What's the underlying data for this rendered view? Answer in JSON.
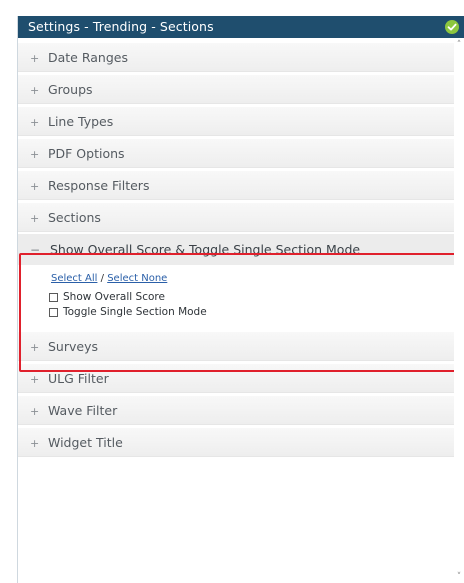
{
  "header": {
    "title": "Settings - Trending - Sections",
    "status_icon": "check-circle-icon",
    "status_color": "#8cc63f",
    "background": "#1f4e6e"
  },
  "sections_before": [
    {
      "sign": "+",
      "label": "Date Ranges"
    },
    {
      "sign": "+",
      "label": "Groups"
    },
    {
      "sign": "+",
      "label": "Line Types"
    },
    {
      "sign": "+",
      "label": "PDF Options"
    },
    {
      "sign": "+",
      "label": "Response Filters"
    },
    {
      "sign": "+",
      "label": "Sections"
    }
  ],
  "expanded": {
    "sign": "−",
    "label": "Show Overall Score & Toggle Single Section Mode",
    "select_all": "Select All",
    "separator": "/",
    "select_none": "Select None",
    "options": [
      {
        "label": "Show Overall Score",
        "checked": false
      },
      {
        "label": "Toggle Single Section Mode",
        "checked": false
      }
    ],
    "highlight_color": "#e0202c"
  },
  "sections_after": [
    {
      "sign": "+",
      "label": "Surveys"
    },
    {
      "sign": "+",
      "label": "ULG Filter"
    },
    {
      "sign": "+",
      "label": "Wave Filter"
    },
    {
      "sign": "+",
      "label": "Widget Title"
    }
  ],
  "scrollbar": {
    "up_icon": "scroll-up-arrow-icon",
    "down_icon": "scroll-down-arrow-icon"
  }
}
